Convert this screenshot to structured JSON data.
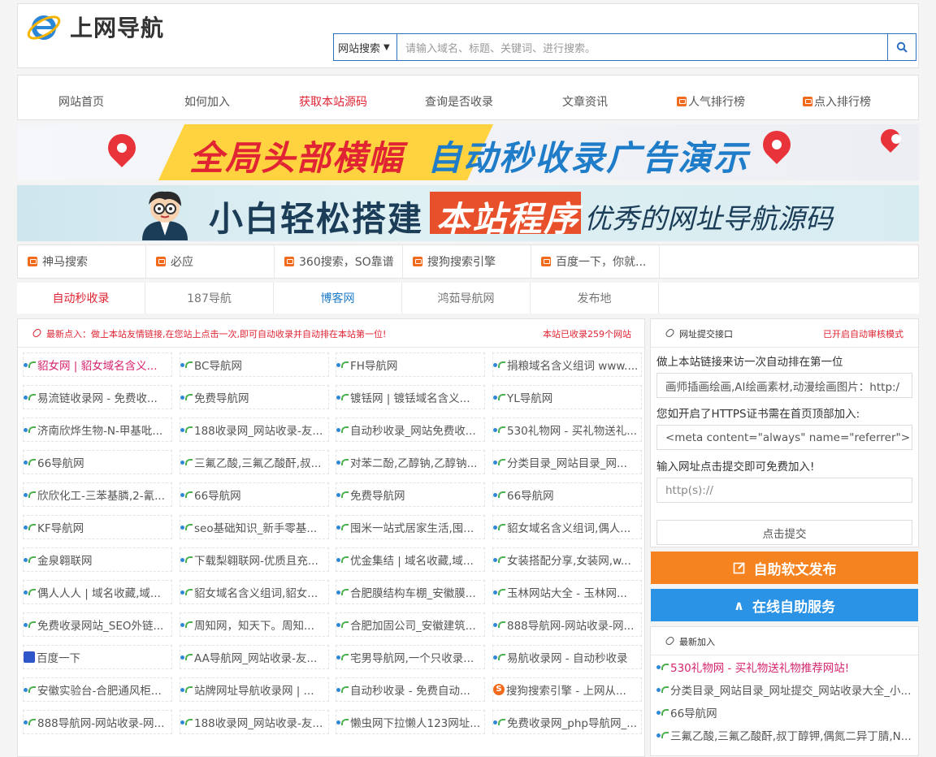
{
  "header": {
    "logo_text": "上网导航",
    "search_type": "网站搜索",
    "search_placeholder": "请输入域名、标题、关键词、进行搜索。"
  },
  "nav": [
    {
      "label": "网站首页",
      "color": "#555"
    },
    {
      "label": "如何加入",
      "color": "#555"
    },
    {
      "label": "获取本站源码",
      "color": "#e02433"
    },
    {
      "label": "查询是否收录",
      "color": "#555"
    },
    {
      "label": "文章资讯",
      "color": "#555"
    },
    {
      "label": "人气排行榜",
      "color": "#555",
      "hot": true
    },
    {
      "label": "点入排行榜",
      "color": "#555",
      "hot": true
    }
  ],
  "banner1": {
    "part1": "全局头部横幅",
    "part2": "自动秒收录广告演示"
  },
  "banner2": {
    "part1": "小白轻松搭建",
    "part2": "本站程序",
    "part3": "优秀的网址导航源码"
  },
  "quick_links": [
    "神马搜索",
    "必应",
    "360搜索，SO靠谱",
    "搜狗搜索引擎",
    "百度一下，你就..."
  ],
  "friend_links": [
    {
      "label": "自动秒收录",
      "color": "#e02433"
    },
    {
      "label": "187导航",
      "color": "#777"
    },
    {
      "label": "博客网",
      "color": "#1e7cc8"
    },
    {
      "label": "鸿茹导航网",
      "color": "#777"
    },
    {
      "label": "发布地",
      "color": "#777"
    }
  ],
  "main": {
    "notice": "最新点入：做上本站友情链接,在您站上点击一次,即可自动收录并自动排在本站第一位!",
    "count": "本站已收录259个网站",
    "sites": [
      {
        "label": "貂女网 | 貂女域名含义...",
        "color": "#d6246e"
      },
      {
        "label": "BC导航网"
      },
      {
        "label": "FH导航网"
      },
      {
        "label": "捐粮域名含义组词 www...."
      },
      {
        "label": "易流链收录网 - 免费收..."
      },
      {
        "label": "免费导航网"
      },
      {
        "label": "镀铥网 | 镀铥域名含义..."
      },
      {
        "label": "YL导航网"
      },
      {
        "label": "济南欣烨生物-N-甲基吡..."
      },
      {
        "label": "188收录网_网站收录-友..."
      },
      {
        "label": "自动秒收录_网站免费收..."
      },
      {
        "label": "530礼物网 - 买礼物送礼..."
      },
      {
        "label": "66导航网"
      },
      {
        "label": "三氟乙酸,三氟乙酸酐,叔..."
      },
      {
        "label": "对苯二酚,乙醇钠,乙醇钠..."
      },
      {
        "label": "分类目录_网站目录_网..."
      },
      {
        "label": "欣欣化工-三苯基膦,2-氰..."
      },
      {
        "label": "66导航网"
      },
      {
        "label": "免费导航网"
      },
      {
        "label": "66导航网"
      },
      {
        "label": "KF导航网"
      },
      {
        "label": "seo基础知识_新手零基..."
      },
      {
        "label": "囤米一站式居家生活,囤..."
      },
      {
        "label": "貂女域名含义组词,偶人..."
      },
      {
        "label": "金泉翱联网"
      },
      {
        "label": "下载梨翱联网-优质且充..."
      },
      {
        "label": "优金集结 | 域名收藏,域..."
      },
      {
        "label": "女装搭配分享,女装网,w..."
      },
      {
        "label": "偶人人人 | 域名收藏,域..."
      },
      {
        "label": "貂女域名含义组词,貂女..."
      },
      {
        "label": "合肥膜结构车棚_安徽膜..."
      },
      {
        "label": "玉林网站大全 - 玉林网..."
      },
      {
        "label": "免费收录网站_SEO外链..."
      },
      {
        "label": "周知网，知天下。周知..."
      },
      {
        "label": "合肥加固公司_安徽建筑..."
      },
      {
        "label": "888导航网-网站收录-网..."
      },
      {
        "label": "百度一下",
        "icon": "baidu"
      },
      {
        "label": "AA导航网_网站收录-友..."
      },
      {
        "label": "宅男导航网,一个只收录..."
      },
      {
        "label": "易航收录网 - 自动秒收录"
      },
      {
        "label": "安徽实验台-合肥通风柜..."
      },
      {
        "label": "站牌网址导航收录网 | ..."
      },
      {
        "label": "自动秒收录 - 免费自动..."
      },
      {
        "label": "搜狗搜索引擎 - 上网从...",
        "icon": "sogou"
      },
      {
        "label": "888导航网-网站收录-网..."
      },
      {
        "label": "188收录网_网站收录-友..."
      },
      {
        "label": "懒虫网下拉懒人123网址..."
      },
      {
        "label": "免费收录网_php导航网_..."
      }
    ]
  },
  "submit_panel": {
    "title": "网址提交接口",
    "status": "已开启自动审核模式",
    "line1": "做上本站链接来访一次自动排在第一位",
    "field1": "画师插画绘画,AI绘画素材,动漫绘画图片：http:/",
    "line2": "您如开启了HTTPS证书需在首页顶部加入:",
    "field2": "<meta content=\"always\" name=\"referrer\">",
    "line3": "输入网址点击提交即可免费加入!",
    "url_placeholder": "http(s)://",
    "submit_label": "点击提交"
  },
  "buttons": {
    "publish": "自助软文发布",
    "publish_color": "#f5831f",
    "service": "在线自助服务",
    "service_color": "#2b93e6"
  },
  "latest": {
    "title": "最新加入",
    "items": [
      {
        "label": "530礼物网 - 买礼物送礼物推荐网站!",
        "color": "#d6246e"
      },
      {
        "label": "分类目录_网站目录_网址提交_网站收录大全_小..."
      },
      {
        "label": "66导航网"
      },
      {
        "label": "三氟乙酸,三氟乙酸酐,叔丁醇钾,偶氮二异丁腈,N..."
      }
    ]
  }
}
